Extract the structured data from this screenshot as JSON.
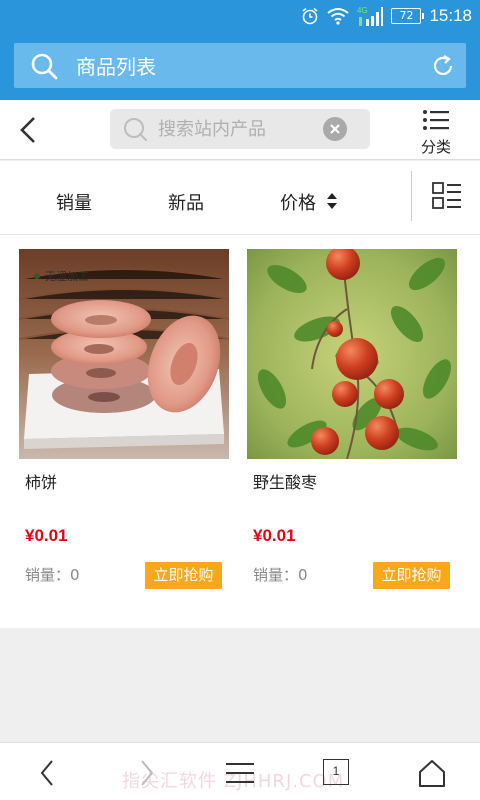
{
  "status_bar": {
    "time": "15:18",
    "battery": "72",
    "network": "4G",
    "icons": [
      "alarm-icon",
      "wifi-icon",
      "signal-icon",
      "battery-icon"
    ]
  },
  "browser": {
    "title": "商品列表",
    "icons": [
      "search-icon",
      "refresh-icon"
    ]
  },
  "header": {
    "search_placeholder": "搜索站内产品",
    "category_label": "分类",
    "icons": [
      "back-arrow-icon",
      "search-icon",
      "clear-icon",
      "list-icon"
    ]
  },
  "sort_bar": {
    "sales": "销量",
    "new": "新品",
    "price": "价格",
    "icons": [
      "sort-arrows-icon",
      "grid-list-toggle-icon"
    ]
  },
  "products": [
    {
      "name": "柿饼",
      "price": "¥0.01",
      "sales_label": "销量：",
      "sales_count": "0",
      "buy_label": "立即抢购",
      "image_caption": "无涩加工"
    },
    {
      "name": "野生酸枣",
      "price": "¥0.01",
      "sales_label": "销量：",
      "sales_count": "0",
      "buy_label": "立即抢购"
    }
  ],
  "bottom_nav": {
    "tab_count": "1",
    "watermark": "指尖汇软件 ZJHHRJ.COM",
    "icons": [
      "back-icon",
      "forward-icon",
      "menu-icon",
      "tabs-icon",
      "home-icon"
    ]
  },
  "colors": {
    "primary": "#2a95da",
    "price": "#e60012",
    "buy_button": "#f9a71b"
  }
}
